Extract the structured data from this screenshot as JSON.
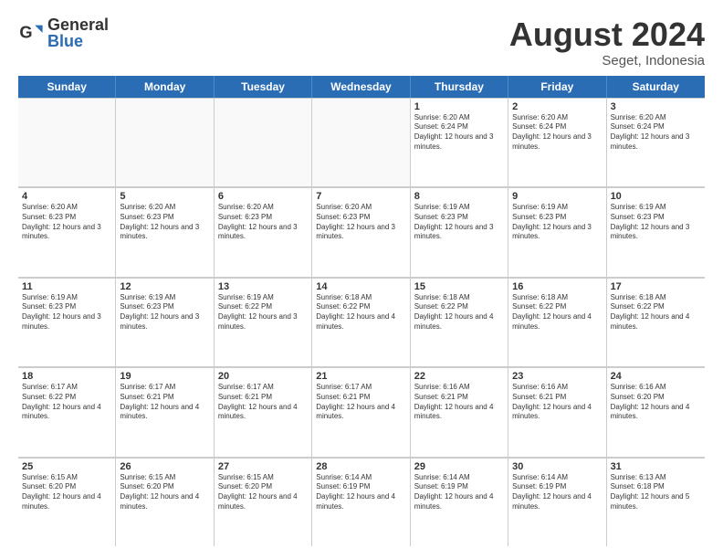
{
  "header": {
    "logo_general": "General",
    "logo_blue": "Blue",
    "month_year": "August 2024",
    "location": "Seget, Indonesia"
  },
  "days_of_week": [
    "Sunday",
    "Monday",
    "Tuesday",
    "Wednesday",
    "Thursday",
    "Friday",
    "Saturday"
  ],
  "weeks": [
    [
      {
        "day": "",
        "info": ""
      },
      {
        "day": "",
        "info": ""
      },
      {
        "day": "",
        "info": ""
      },
      {
        "day": "",
        "info": ""
      },
      {
        "day": "1",
        "sunrise": "6:20 AM",
        "sunset": "6:24 PM",
        "daylight": "12 hours and 3 minutes."
      },
      {
        "day": "2",
        "sunrise": "6:20 AM",
        "sunset": "6:24 PM",
        "daylight": "12 hours and 3 minutes."
      },
      {
        "day": "3",
        "sunrise": "6:20 AM",
        "sunset": "6:24 PM",
        "daylight": "12 hours and 3 minutes."
      }
    ],
    [
      {
        "day": "4",
        "sunrise": "6:20 AM",
        "sunset": "6:23 PM",
        "daylight": "12 hours and 3 minutes."
      },
      {
        "day": "5",
        "sunrise": "6:20 AM",
        "sunset": "6:23 PM",
        "daylight": "12 hours and 3 minutes."
      },
      {
        "day": "6",
        "sunrise": "6:20 AM",
        "sunset": "6:23 PM",
        "daylight": "12 hours and 3 minutes."
      },
      {
        "day": "7",
        "sunrise": "6:20 AM",
        "sunset": "6:23 PM",
        "daylight": "12 hours and 3 minutes."
      },
      {
        "day": "8",
        "sunrise": "6:19 AM",
        "sunset": "6:23 PM",
        "daylight": "12 hours and 3 minutes."
      },
      {
        "day": "9",
        "sunrise": "6:19 AM",
        "sunset": "6:23 PM",
        "daylight": "12 hours and 3 minutes."
      },
      {
        "day": "10",
        "sunrise": "6:19 AM",
        "sunset": "6:23 PM",
        "daylight": "12 hours and 3 minutes."
      }
    ],
    [
      {
        "day": "11",
        "sunrise": "6:19 AM",
        "sunset": "6:23 PM",
        "daylight": "12 hours and 3 minutes."
      },
      {
        "day": "12",
        "sunrise": "6:19 AM",
        "sunset": "6:23 PM",
        "daylight": "12 hours and 3 minutes."
      },
      {
        "day": "13",
        "sunrise": "6:19 AM",
        "sunset": "6:22 PM",
        "daylight": "12 hours and 3 minutes."
      },
      {
        "day": "14",
        "sunrise": "6:18 AM",
        "sunset": "6:22 PM",
        "daylight": "12 hours and 4 minutes."
      },
      {
        "day": "15",
        "sunrise": "6:18 AM",
        "sunset": "6:22 PM",
        "daylight": "12 hours and 4 minutes."
      },
      {
        "day": "16",
        "sunrise": "6:18 AM",
        "sunset": "6:22 PM",
        "daylight": "12 hours and 4 minutes."
      },
      {
        "day": "17",
        "sunrise": "6:18 AM",
        "sunset": "6:22 PM",
        "daylight": "12 hours and 4 minutes."
      }
    ],
    [
      {
        "day": "18",
        "sunrise": "6:17 AM",
        "sunset": "6:22 PM",
        "daylight": "12 hours and 4 minutes."
      },
      {
        "day": "19",
        "sunrise": "6:17 AM",
        "sunset": "6:21 PM",
        "daylight": "12 hours and 4 minutes."
      },
      {
        "day": "20",
        "sunrise": "6:17 AM",
        "sunset": "6:21 PM",
        "daylight": "12 hours and 4 minutes."
      },
      {
        "day": "21",
        "sunrise": "6:17 AM",
        "sunset": "6:21 PM",
        "daylight": "12 hours and 4 minutes."
      },
      {
        "day": "22",
        "sunrise": "6:16 AM",
        "sunset": "6:21 PM",
        "daylight": "12 hours and 4 minutes."
      },
      {
        "day": "23",
        "sunrise": "6:16 AM",
        "sunset": "6:21 PM",
        "daylight": "12 hours and 4 minutes."
      },
      {
        "day": "24",
        "sunrise": "6:16 AM",
        "sunset": "6:20 PM",
        "daylight": "12 hours and 4 minutes."
      }
    ],
    [
      {
        "day": "25",
        "sunrise": "6:15 AM",
        "sunset": "6:20 PM",
        "daylight": "12 hours and 4 minutes."
      },
      {
        "day": "26",
        "sunrise": "6:15 AM",
        "sunset": "6:20 PM",
        "daylight": "12 hours and 4 minutes."
      },
      {
        "day": "27",
        "sunrise": "6:15 AM",
        "sunset": "6:20 PM",
        "daylight": "12 hours and 4 minutes."
      },
      {
        "day": "28",
        "sunrise": "6:14 AM",
        "sunset": "6:19 PM",
        "daylight": "12 hours and 4 minutes."
      },
      {
        "day": "29",
        "sunrise": "6:14 AM",
        "sunset": "6:19 PM",
        "daylight": "12 hours and 4 minutes."
      },
      {
        "day": "30",
        "sunrise": "6:14 AM",
        "sunset": "6:19 PM",
        "daylight": "12 hours and 4 minutes."
      },
      {
        "day": "31",
        "sunrise": "6:13 AM",
        "sunset": "6:18 PM",
        "daylight": "12 hours and 5 minutes."
      }
    ]
  ],
  "labels": {
    "sunrise": "Sunrise:",
    "sunset": "Sunset:",
    "daylight": "Daylight hours"
  }
}
